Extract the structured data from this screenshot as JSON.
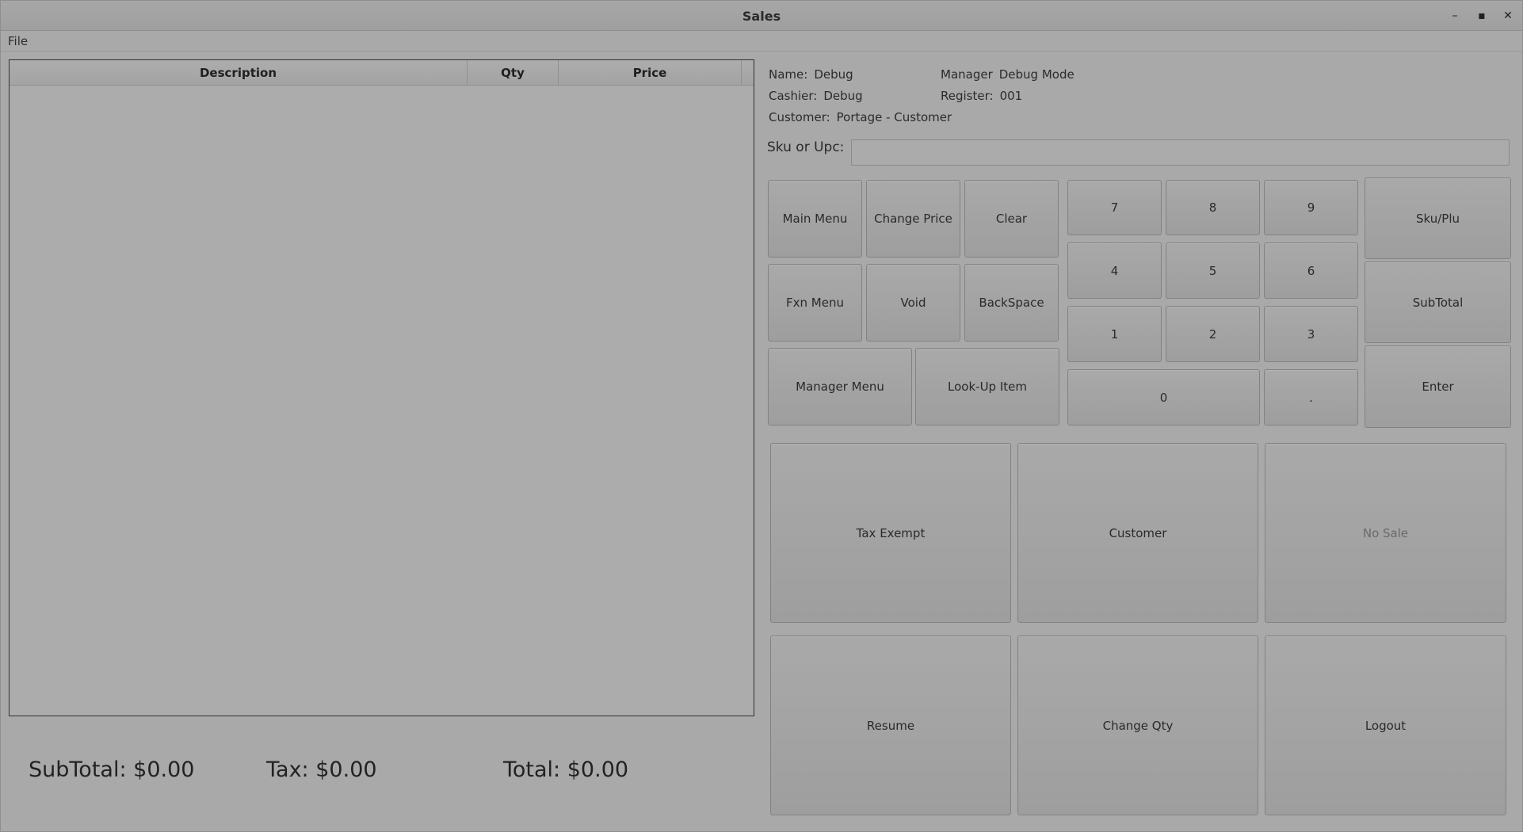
{
  "window": {
    "title": "Sales"
  },
  "window_controls": {
    "minimize": "–",
    "maximize": "▪",
    "close": "✕"
  },
  "menubar": {
    "file": "File"
  },
  "table": {
    "columns": [
      "Description",
      "Qty",
      "Price"
    ],
    "rows": []
  },
  "info": {
    "name_label": "Name:",
    "name_value": "Debug",
    "manager_label": "Manager",
    "manager_value": "Debug Mode",
    "cashier_label": "Cashier:",
    "cashier_value": "Debug",
    "register_label": "Register:",
    "register_value": "001",
    "customer_label": "Customer:",
    "customer_value": "Portage - Customer"
  },
  "sku": {
    "label": "Sku or Upc:",
    "value": "",
    "placeholder": ""
  },
  "function_buttons": {
    "main_menu": "Main Menu",
    "change_price": "Change Price",
    "clear": "Clear",
    "fxn_menu": "Fxn Menu",
    "void": "Void",
    "backspace": "BackSpace",
    "manager_menu": "Manager Menu",
    "look_up_item": "Look-Up Item"
  },
  "keypad": {
    "k7": "7",
    "k8": "8",
    "k9": "9",
    "k4": "4",
    "k5": "5",
    "k6": "6",
    "k1": "1",
    "k2": "2",
    "k3": "3",
    "k0": "0",
    "kdot": "."
  },
  "action_buttons": {
    "sku_plu": "Sku/Plu",
    "subtotal": "SubTotal",
    "enter": "Enter"
  },
  "large_buttons": {
    "tax_exempt": "Tax Exempt",
    "customer": "Customer",
    "no_sale": "No Sale",
    "resume": "Resume",
    "change_qty": "Change Qty",
    "logout": "Logout"
  },
  "totals": {
    "subtotal_label": "SubTotal:",
    "subtotal_value": "$0.00",
    "tax_label": "Tax:",
    "tax_value": "$0.00",
    "total_label": "Total:",
    "total_value": "$0.00"
  }
}
